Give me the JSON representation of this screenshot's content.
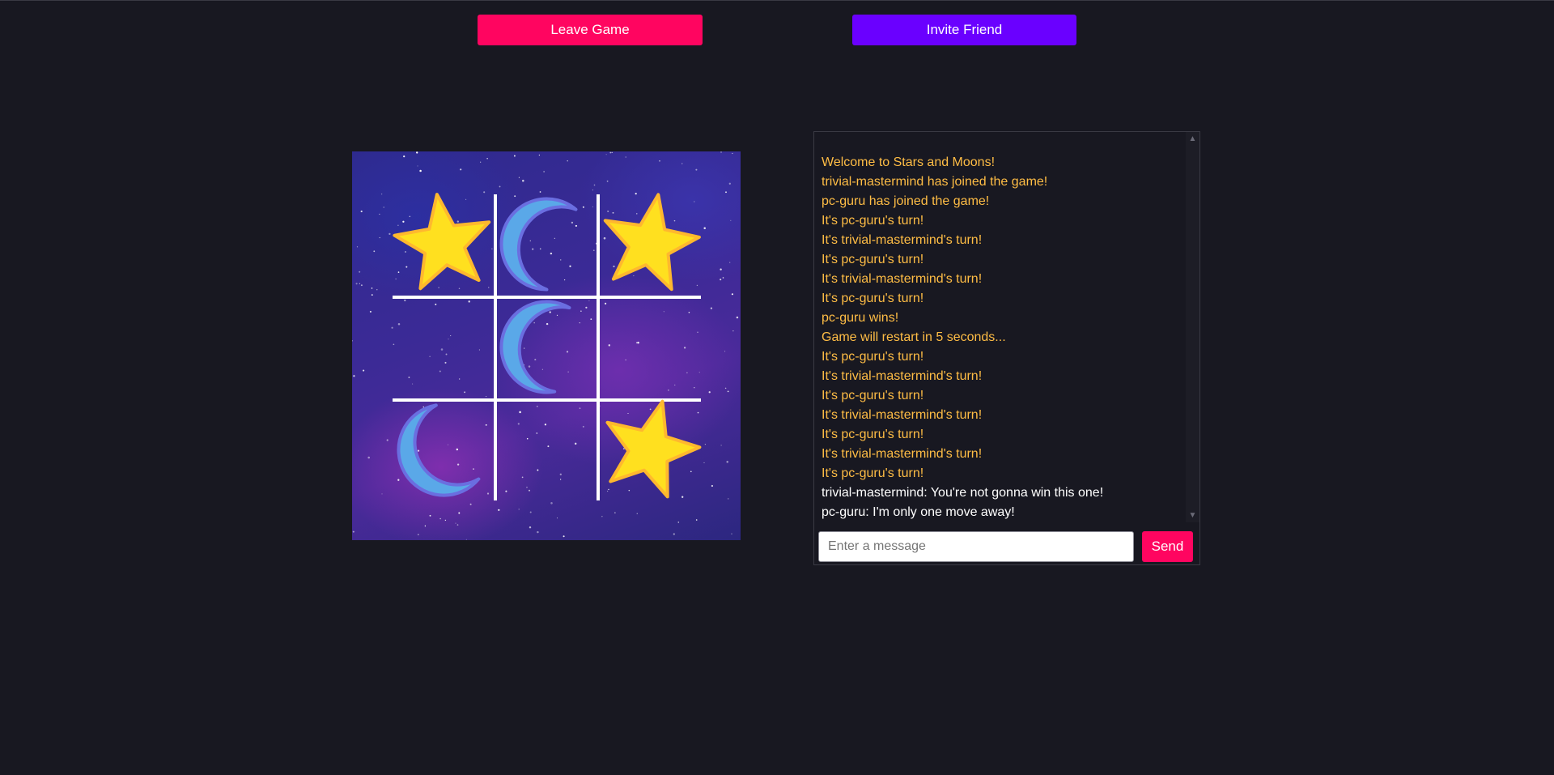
{
  "header": {
    "leave_label": "Leave Game",
    "invite_label": "Invite Friend"
  },
  "board": {
    "cells": [
      [
        "star",
        "moon",
        "star"
      ],
      [
        "",
        "moon",
        ""
      ],
      [
        "moon",
        "",
        "star"
      ]
    ],
    "colors": {
      "star_fill": "#ffe01f",
      "star_stroke": "#ffb82e",
      "moon_fill": "#5aa8e8",
      "moon_stroke": "#6a6ee0",
      "grid_line": "#ffffff"
    }
  },
  "chat": {
    "messages": [
      {
        "kind": "system",
        "text": "Welcome to Stars and Moons!"
      },
      {
        "kind": "system",
        "text": "trivial-mastermind has joined the game!"
      },
      {
        "kind": "system",
        "text": "pc-guru has joined the game!"
      },
      {
        "kind": "system",
        "text": "It's pc-guru's turn!"
      },
      {
        "kind": "system",
        "text": "It's trivial-mastermind's turn!"
      },
      {
        "kind": "system",
        "text": "It's pc-guru's turn!"
      },
      {
        "kind": "system",
        "text": "It's trivial-mastermind's turn!"
      },
      {
        "kind": "system",
        "text": "It's pc-guru's turn!"
      },
      {
        "kind": "system",
        "text": "pc-guru wins!"
      },
      {
        "kind": "system",
        "text": "Game will restart in 5 seconds..."
      },
      {
        "kind": "system",
        "text": "It's pc-guru's turn!"
      },
      {
        "kind": "system",
        "text": "It's trivial-mastermind's turn!"
      },
      {
        "kind": "system",
        "text": "It's pc-guru's turn!"
      },
      {
        "kind": "system",
        "text": "It's trivial-mastermind's turn!"
      },
      {
        "kind": "system",
        "text": "It's pc-guru's turn!"
      },
      {
        "kind": "system",
        "text": "It's trivial-mastermind's turn!"
      },
      {
        "kind": "system",
        "text": "It's pc-guru's turn!"
      },
      {
        "kind": "chat",
        "text": "trivial-mastermind: You're not gonna win this one!"
      },
      {
        "kind": "chat",
        "text": "pc-guru: I'm only one move away!"
      }
    ],
    "input": {
      "value": "",
      "placeholder": "Enter a message"
    },
    "send_label": "Send"
  }
}
